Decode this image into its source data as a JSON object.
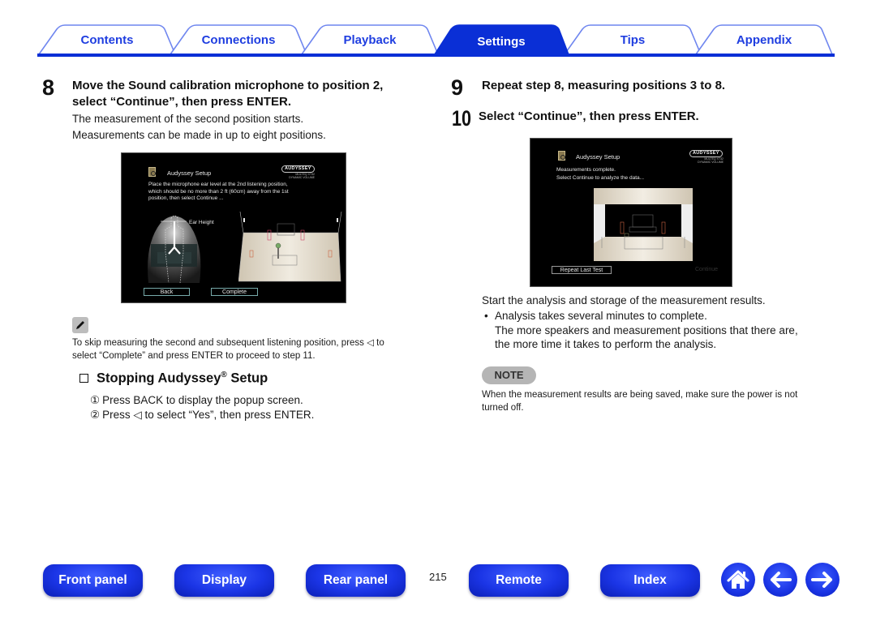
{
  "tabs": [
    {
      "label": "Contents",
      "active": false
    },
    {
      "label": "Connections",
      "active": false
    },
    {
      "label": "Playback",
      "active": false
    },
    {
      "label": "Settings",
      "active": true
    },
    {
      "label": "Tips",
      "active": false
    },
    {
      "label": "Appendix",
      "active": false
    }
  ],
  "colors": {
    "accent": "#0a2fd6",
    "tab_text": "#1f3ee0",
    "nav_button": "#1b35e6"
  },
  "left": {
    "step8": {
      "number": "8",
      "title_line1": "Move the Sound calibration microphone to position 2,",
      "title_line2": "select “Continue”, then press ENTER.",
      "desc1": "The measurement of the second position starts.",
      "desc2": "Measurements can be made in up to eight positions."
    },
    "screen": {
      "title": "Audyssey Setup",
      "logo": "AUDYSSEY",
      "logo_sub1": "MULTEQ XT32",
      "logo_sub2": "DYNAMIC VOLUME",
      "msg1": "Place the microphone ear level at the 2nd listening position,",
      "msg2": "which should be no more than 2 ft (60cm) away from the 1st",
      "msg3": "position, then select  Continue ...",
      "ear_height": "Ear Height",
      "btn_back": "Back",
      "btn_complete": "Complete"
    },
    "tip_icon": "pencil-icon",
    "tip_line1": "To skip measuring the second and subsequent listening position, press ◁ to",
    "tip_line2": "select “Complete” and press ENTER to proceed to step 11.",
    "section": {
      "title": "Stopping Audyssey",
      "reg": "®",
      "title_end": " Setup"
    },
    "steps": [
      {
        "marker": "①",
        "text": "Press BACK to display the popup screen."
      },
      {
        "marker": "②",
        "text": "Press ◁ to select “Yes”, then press ENTER."
      }
    ]
  },
  "right": {
    "step9": {
      "number": "9",
      "title": "Repeat step 8, measuring positions 3 to 8."
    },
    "step10": {
      "number": "10",
      "title": "Select “Continue”, then press ENTER."
    },
    "screen": {
      "title": "Audyssey Setup",
      "logo": "AUDYSSEY",
      "logo_sub1": "MULTEQ XT32",
      "logo_sub2": "DYNAMIC VOLUME",
      "msg1": "Measurements complete.",
      "msg2": "Select Continue to analyze the data...",
      "btn_repeat": "Repeat Last Test",
      "btn_continue": "Continue"
    },
    "desc": "Start the analysis and storage of the measurement results.",
    "bullet1": "Analysis takes several minutes to complete.",
    "bullet1_cont1": "The more speakers and measurement positions that there are,",
    "bullet1_cont2": "the more time it takes to perform the analysis.",
    "note_label": "NOTE",
    "note_line1": "When the measurement results are being saved, make sure the power is not",
    "note_line2": "turned off."
  },
  "footer": {
    "buttons": [
      "Front panel",
      "Display",
      "Rear panel",
      "Remote",
      "Index"
    ],
    "page_number": "215",
    "icons": [
      "home-icon",
      "back-arrow-icon",
      "forward-arrow-icon"
    ]
  }
}
